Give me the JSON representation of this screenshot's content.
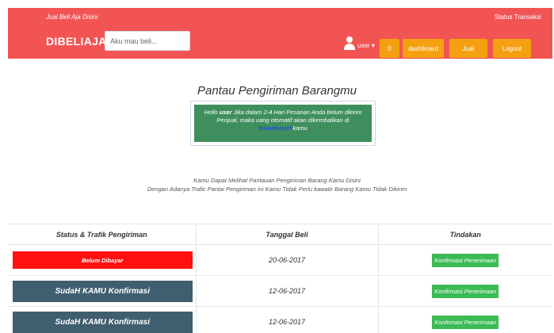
{
  "header": {
    "tagline": "Jual Beli Aja Disini",
    "status_link": "Status Transaksi",
    "brand": "DIBELIAJA",
    "search_placeholder": "Aku mau beli...",
    "user_label": "user ▾",
    "nav": {
      "cart_count": "0",
      "dashboard": "dashboard",
      "sell": "Jual",
      "logout": "Logout"
    },
    "colors": {
      "bar": "#f25454",
      "button": "#f5a011"
    }
  },
  "page": {
    "title": "Pantau Pengiriman Barangmu",
    "alert": {
      "hello": "Hello ",
      "user": "user",
      "text": " Jika dalam 2-4 Hari Pesanan Anda belum dikirim Penjual, maka uang otomatif akan dikembalikan di ",
      "link": "bukadompet",
      "suffix": " kamu"
    },
    "info_line1": "Kamu Dapat Melihat Pantauan Pengiriman Barang Kamu Disini",
    "info_line2": "Dengan Adanya Trafic Pantai Pengiriman ini Kamu Tidak Perlu kawatir Barang Kamu Tidak Dikirim"
  },
  "table": {
    "headers": {
      "status": "Status & Trafik Pengiriman",
      "date": "Tanggal Beli",
      "action": "Tindakan"
    },
    "rows": [
      {
        "status": "Belum Dibayar",
        "date": "20-06-2017",
        "action": "Konfirmasi Penerimaan"
      },
      {
        "status": "SudaH KAMU Konfirmasi",
        "date": "12-06-2017",
        "action": "Konfirmasi Penerimaan"
      },
      {
        "status": "SudaH KAMU Konfirmasi",
        "date": "12-06-2017",
        "action": "Konfirmasi Penerimaan"
      }
    ]
  }
}
